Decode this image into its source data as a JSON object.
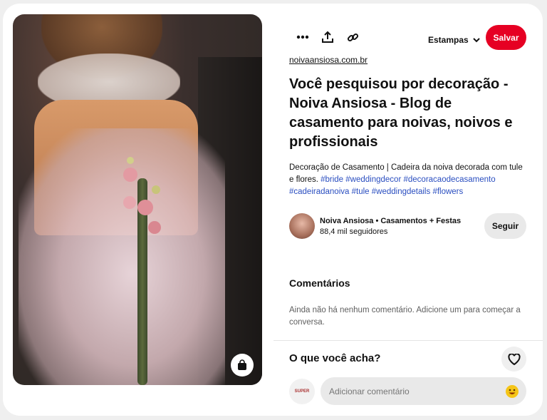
{
  "image": {
    "alt_icon": "shopping-bag-icon"
  },
  "toolbar": {
    "more_icon": "more-icon",
    "share_icon": "share-icon",
    "link_icon": "link-icon",
    "board_label": "Estampas",
    "save_label": "Salvar",
    "save_color": "#e60023"
  },
  "pin": {
    "source": "noivaansiosa.com.br",
    "title": "Você pesquisou por decoração - Noiva Ansiosa - Blog de casamento para noivas, noivos e profissionais",
    "description_text": "Decoração de Casamento | Cadeira da noiva decorada com tule e flores. ",
    "hashtags": [
      "#bride",
      "#weddingdecor",
      "#decoracaodecasamento",
      "#cadeiradanoiva",
      "#tule",
      "#weddingdetails",
      "#flowers"
    ],
    "tag_color": "#2a4ec0"
  },
  "author": {
    "name": "Noiva Ansiosa • Casamentos + Festas",
    "followers": "88,4 mil seguidores",
    "follow_label": "Seguir"
  },
  "comments": {
    "heading": "Comentários",
    "empty_text": "Ainda não há nenhum comentário. Adicione um para começar a conversa.",
    "prompt": "O que você acha?",
    "input_placeholder": "Adicionar comentário",
    "user_avatar_text": "SUPER"
  }
}
